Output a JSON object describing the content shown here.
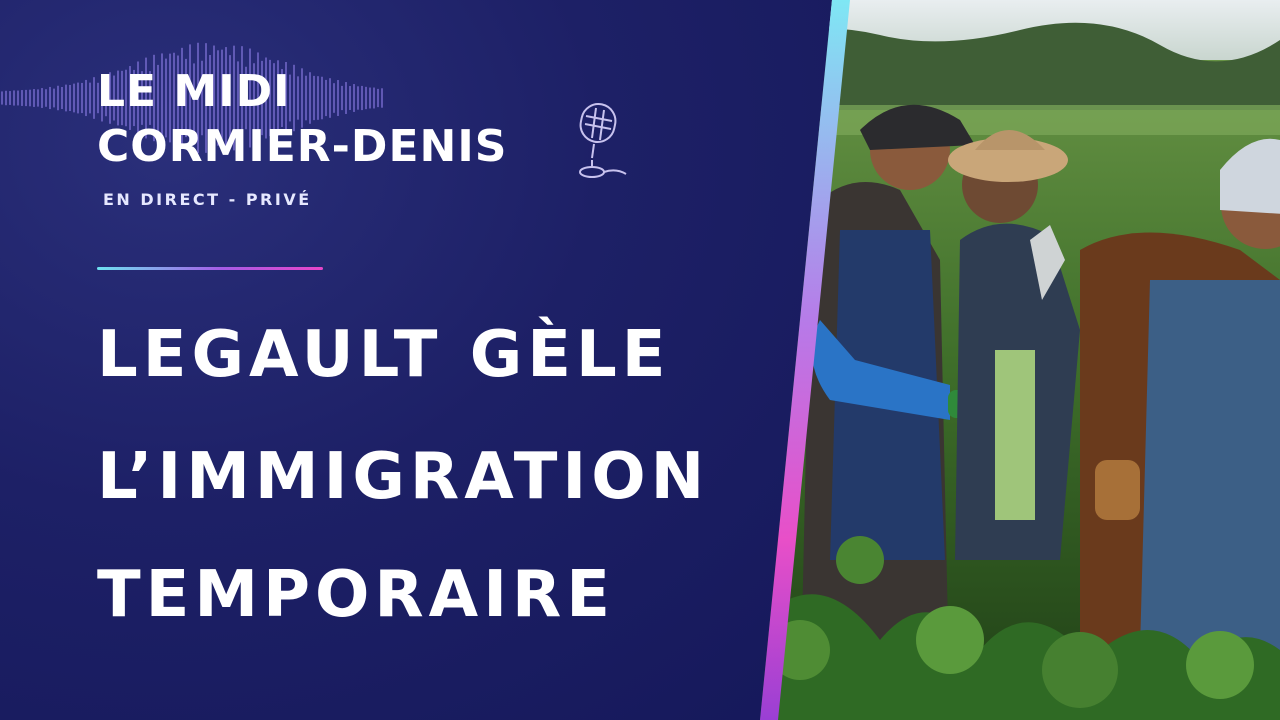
{
  "show": {
    "title_line1": "LE MIDI",
    "title_line2": "CORMIER-DENIS",
    "tagline": "EN DIRECT - PRIVÉ"
  },
  "headline": {
    "line1": "LEGAULT GÈLE",
    "line2": "L’IMMIGRATION",
    "line3": "TEMPORAIRE"
  },
  "icons": {
    "microphone": "microphone-icon",
    "waveform": "waveform-decoration"
  },
  "colors": {
    "panel_navy": "#1d2066",
    "text": "#ffffff",
    "accent_cyan": "#6ee2f0",
    "accent_purple": "#a55ce6",
    "accent_pink": "#e845c8"
  }
}
